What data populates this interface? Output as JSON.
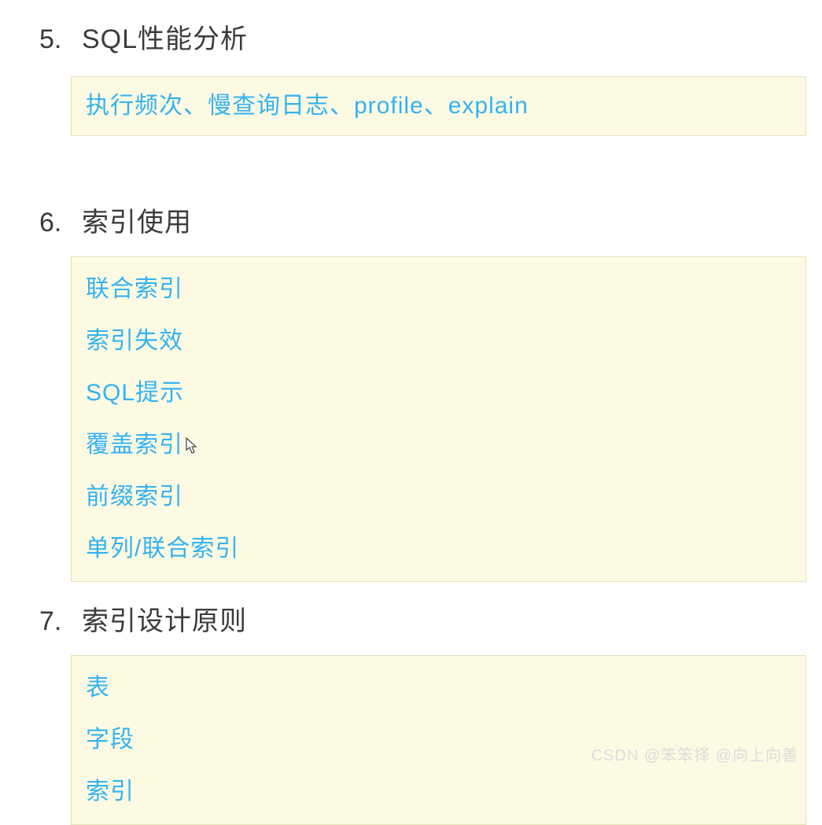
{
  "sections": [
    {
      "number": "5.",
      "title": "SQL性能分析",
      "items": [
        "执行频次、慢查询日志、profile、explain"
      ]
    },
    {
      "number": "6.",
      "title": "索引使用",
      "items": [
        "联合索引",
        "索引失效",
        "SQL提示",
        "覆盖索引",
        "前缀索引",
        "单列/联合索引"
      ]
    },
    {
      "number": "7.",
      "title": "索引设计原则",
      "items": [
        "表",
        "字段",
        "索引"
      ]
    }
  ],
  "watermark": "CSDN @笨笨择 @向上向善"
}
